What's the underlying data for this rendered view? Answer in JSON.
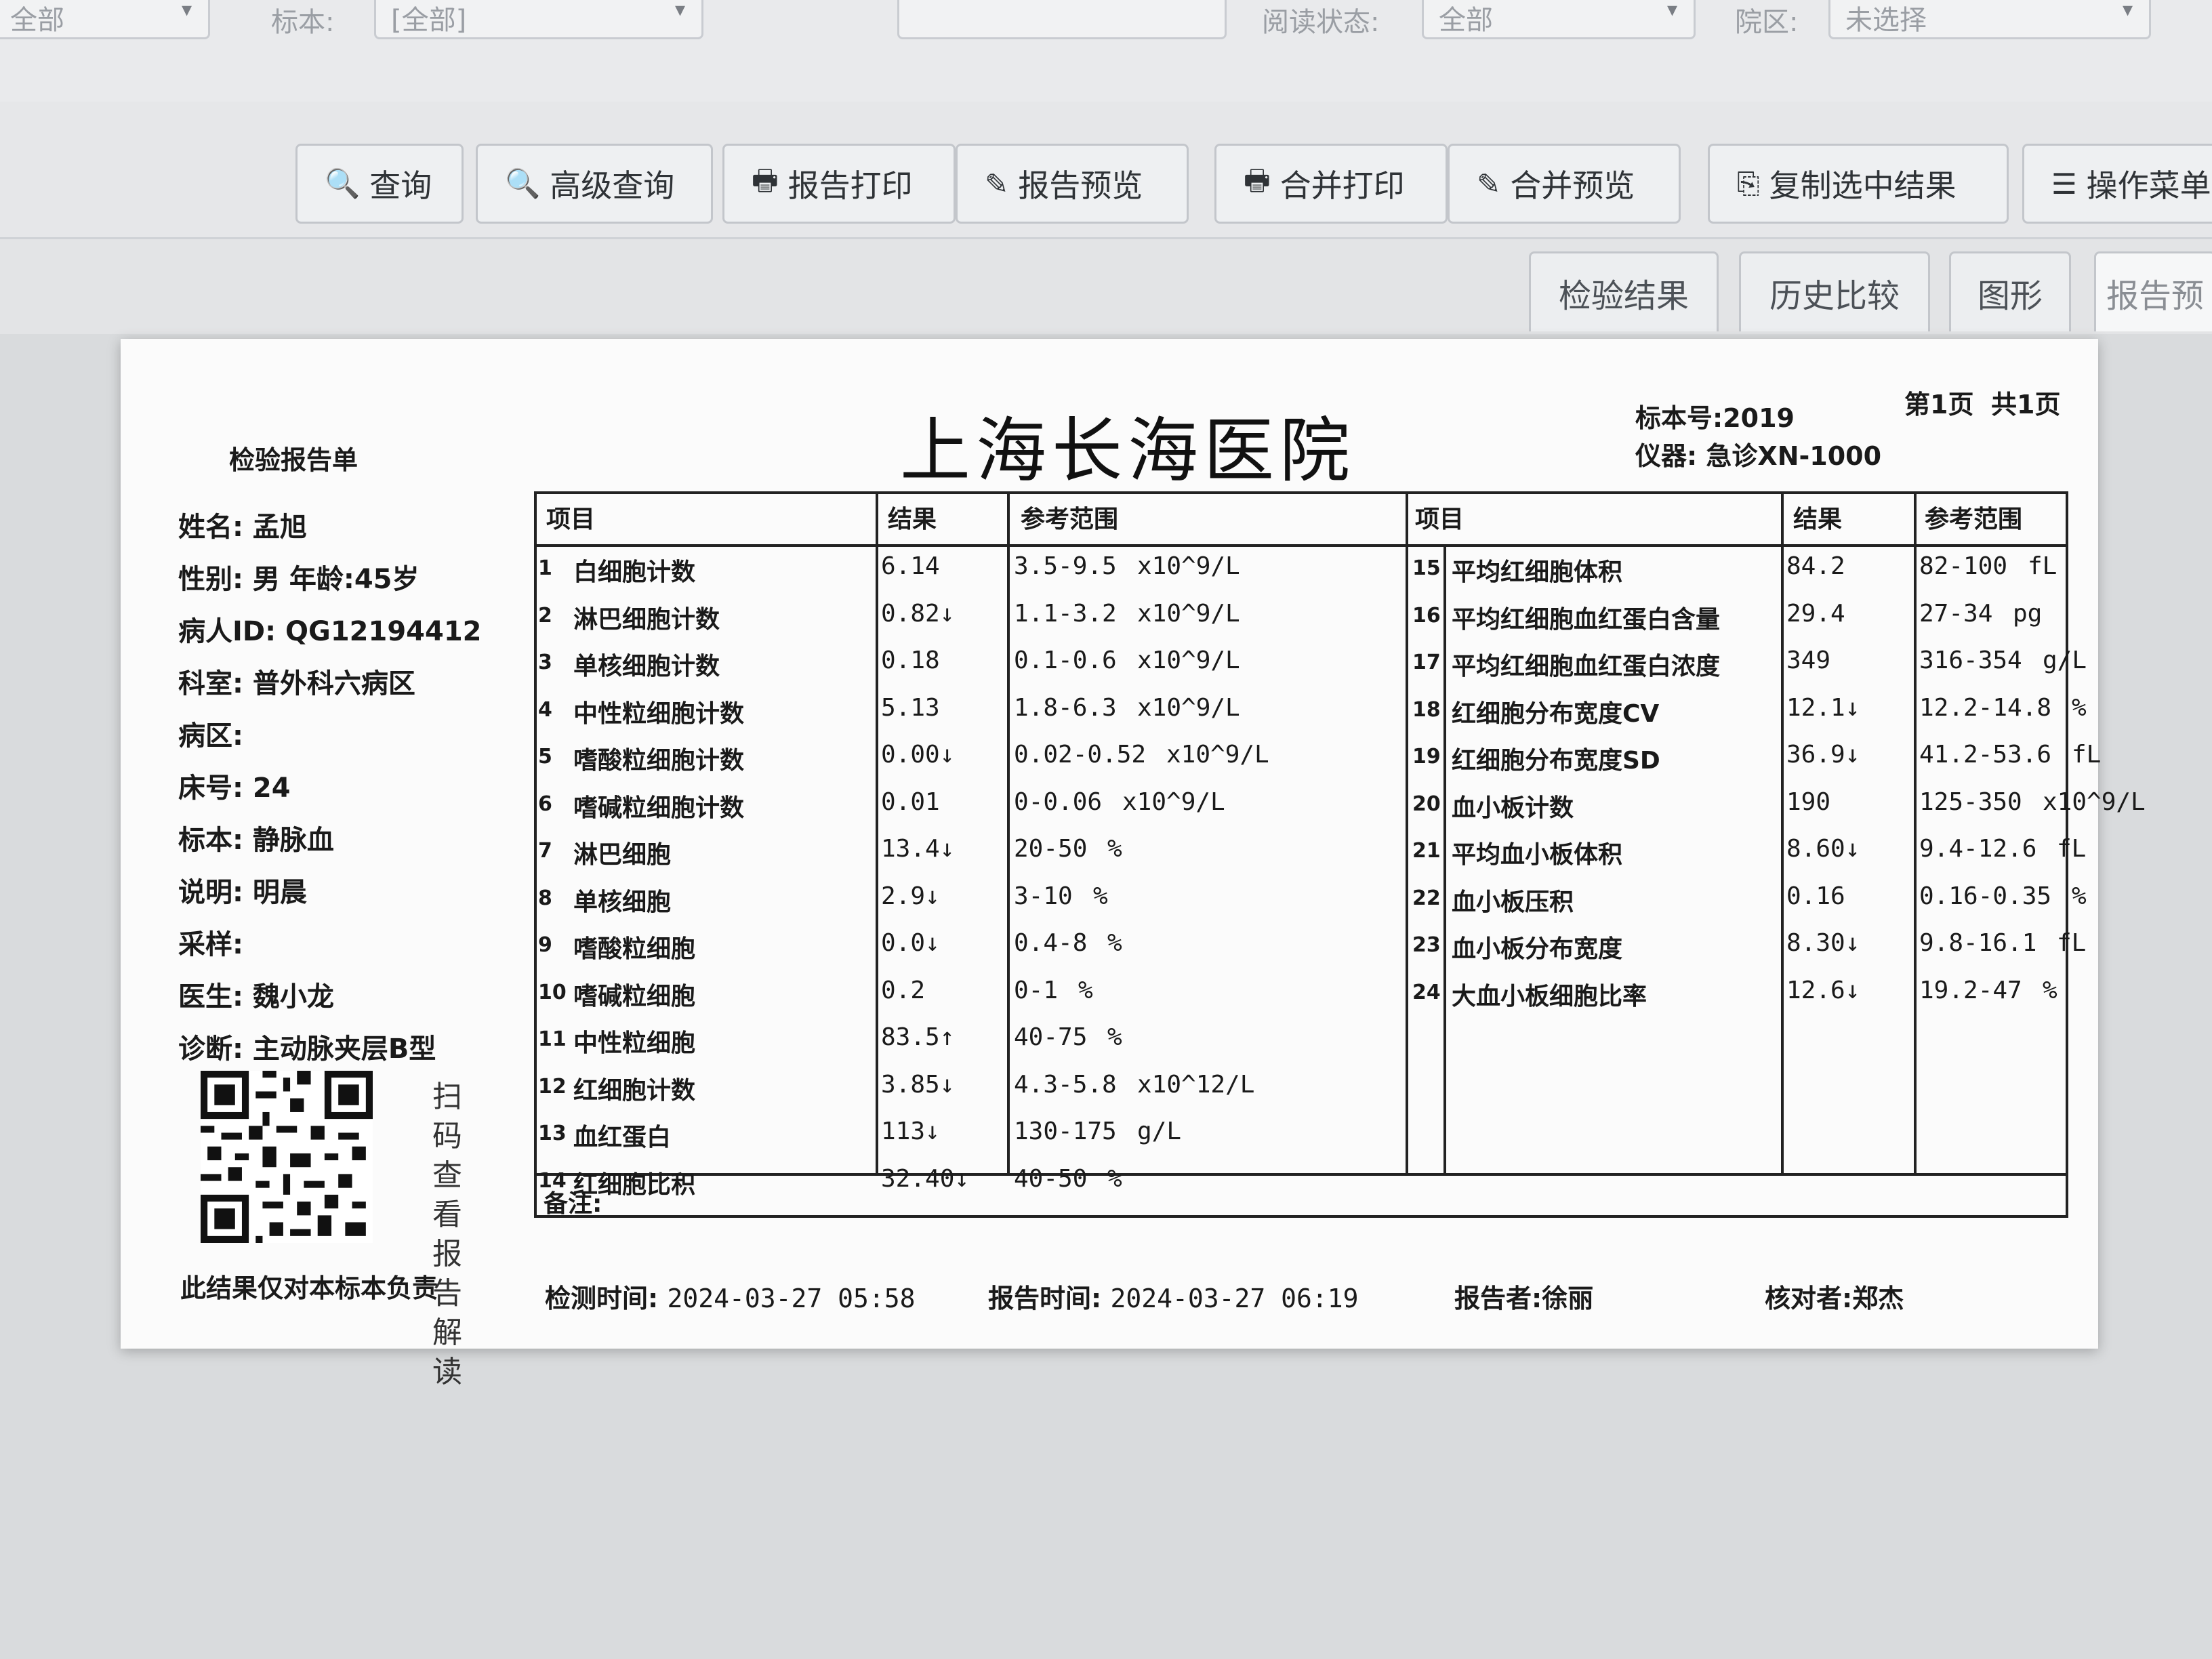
{
  "filters": [
    {
      "label": "",
      "value": "全部"
    },
    {
      "label": "标本:",
      "value": "[全部]"
    },
    {
      "label": "",
      "value": ""
    },
    {
      "label": "阅读状态:",
      "value": "全部"
    },
    {
      "label": "院区:",
      "value": "未选择"
    }
  ],
  "toolbar": {
    "buttons": [
      {
        "icon": "search-icon",
        "glyph": "🔍",
        "label": "查询"
      },
      {
        "icon": "search-icon",
        "glyph": "🔍",
        "label": "高级查询"
      },
      {
        "icon": "printer-icon",
        "glyph": "🖶",
        "label": "报告打印"
      },
      {
        "icon": "edit-icon",
        "glyph": "✎",
        "label": "报告预览"
      },
      {
        "icon": "printer-icon",
        "glyph": "🖶",
        "label": "合并打印"
      },
      {
        "icon": "edit-icon",
        "glyph": "✎",
        "label": "合并预览"
      },
      {
        "icon": "copy-icon",
        "glyph": "⎘",
        "label": "复制选中结果"
      },
      {
        "icon": "menu-icon",
        "glyph": "☰",
        "label": "操作菜单"
      }
    ]
  },
  "tabs": [
    {
      "label": "检验结果"
    },
    {
      "label": "历史比较"
    },
    {
      "label": "图形"
    },
    {
      "label": "报告预"
    }
  ],
  "report": {
    "hospital": "上海长海医院",
    "doc_type": "检验报告单",
    "specimen_no": "标本号:2019",
    "instrument": "仪器:  急诊XN-1000",
    "page": "第1页",
    "total": "共1页",
    "patient": [
      "姓名: 孟旭",
      "性别: 男 年龄:45岁",
      "病人ID: QG12194412",
      "科室: 普外科六病区",
      "病区:",
      "床号: 24",
      "标本: 静脉血",
      "说明: 明晨",
      "采样:",
      "医生: 魏小龙",
      "诊断: 主动脉夹层B型"
    ],
    "qr_caption": "扫码查看报告解读",
    "disclaimer": "此结果仅对本标本负责",
    "headers": {
      "item": "项目",
      "result": "结果",
      "range": "参考范围"
    },
    "left_rows": [
      {
        "no": "1",
        "name": "白细胞计数",
        "result": "6.14",
        "range": "3.5-9.5",
        "unit": "x10^9/L"
      },
      {
        "no": "2",
        "name": "淋巴细胞计数",
        "result": "0.82↓",
        "range": "1.1-3.2",
        "unit": "x10^9/L"
      },
      {
        "no": "3",
        "name": "单核细胞计数",
        "result": "0.18",
        "range": "0.1-0.6",
        "unit": "x10^9/L"
      },
      {
        "no": "4",
        "name": "中性粒细胞计数",
        "result": "5.13",
        "range": "1.8-6.3",
        "unit": "x10^9/L"
      },
      {
        "no": "5",
        "name": "嗜酸粒细胞计数",
        "result": "0.00↓",
        "range": "0.02-0.52",
        "unit": "x10^9/L"
      },
      {
        "no": "6",
        "name": "嗜碱粒细胞计数",
        "result": "0.01",
        "range": "0-0.06",
        "unit": "x10^9/L"
      },
      {
        "no": "7",
        "name": "淋巴细胞",
        "result": "13.4↓",
        "range": "20-50",
        "unit": "%"
      },
      {
        "no": "8",
        "name": "单核细胞",
        "result": "2.9↓",
        "range": "3-10",
        "unit": "%"
      },
      {
        "no": "9",
        "name": "嗜酸粒细胞",
        "result": "0.0↓",
        "range": "0.4-8",
        "unit": "%"
      },
      {
        "no": "10",
        "name": "嗜碱粒细胞",
        "result": "0.2",
        "range": "0-1",
        "unit": "%"
      },
      {
        "no": "11",
        "name": "中性粒细胞",
        "result": "83.5↑",
        "range": "40-75",
        "unit": "%"
      },
      {
        "no": "12",
        "name": "红细胞计数",
        "result": "3.85↓",
        "range": "4.3-5.8",
        "unit": "x10^12/L"
      },
      {
        "no": "13",
        "name": "血红蛋白",
        "result": "113↓",
        "range": "130-175",
        "unit": "g/L"
      },
      {
        "no": "14",
        "name": "红细胞比积",
        "result": "32.40↓",
        "range": "40-50",
        "unit": "%"
      }
    ],
    "right_rows": [
      {
        "no": "15",
        "name": "平均红细胞体积",
        "result": "84.2",
        "range": "82-100",
        "unit": "fL"
      },
      {
        "no": "16",
        "name": "平均红细胞血红蛋白含量",
        "result": "29.4",
        "range": "27-34",
        "unit": "pg"
      },
      {
        "no": "17",
        "name": "平均红细胞血红蛋白浓度",
        "result": "349",
        "range": "316-354",
        "unit": "g/L"
      },
      {
        "no": "18",
        "name": "红细胞分布宽度CV",
        "result": "12.1↓",
        "range": "12.2-14.8",
        "unit": "%"
      },
      {
        "no": "19",
        "name": "红细胞分布宽度SD",
        "result": "36.9↓",
        "range": "41.2-53.6",
        "unit": "fL"
      },
      {
        "no": "20",
        "name": "血小板计数",
        "result": "190",
        "range": "125-350",
        "unit": "x10^9/L"
      },
      {
        "no": "21",
        "name": "平均血小板体积",
        "result": "8.60↓",
        "range": "9.4-12.6",
        "unit": "fL"
      },
      {
        "no": "22",
        "name": "血小板压积",
        "result": "0.16",
        "range": "0.16-0.35",
        "unit": "%"
      },
      {
        "no": "23",
        "name": "血小板分布宽度",
        "result": "8.30↓",
        "range": "9.8-16.1",
        "unit": "fL"
      },
      {
        "no": "24",
        "name": "大血小板细胞比率",
        "result": "12.6↓",
        "range": "19.2-47",
        "unit": "%"
      }
    ],
    "remark_label": "备注:",
    "footer": {
      "test_time_label": "检测时间:",
      "test_time": "2024-03-27 05:58",
      "report_time_label": "报告时间:",
      "report_time": "2024-03-27 06:19",
      "reporter": "报告者:徐丽",
      "checker": "核对者:郑杰"
    }
  }
}
